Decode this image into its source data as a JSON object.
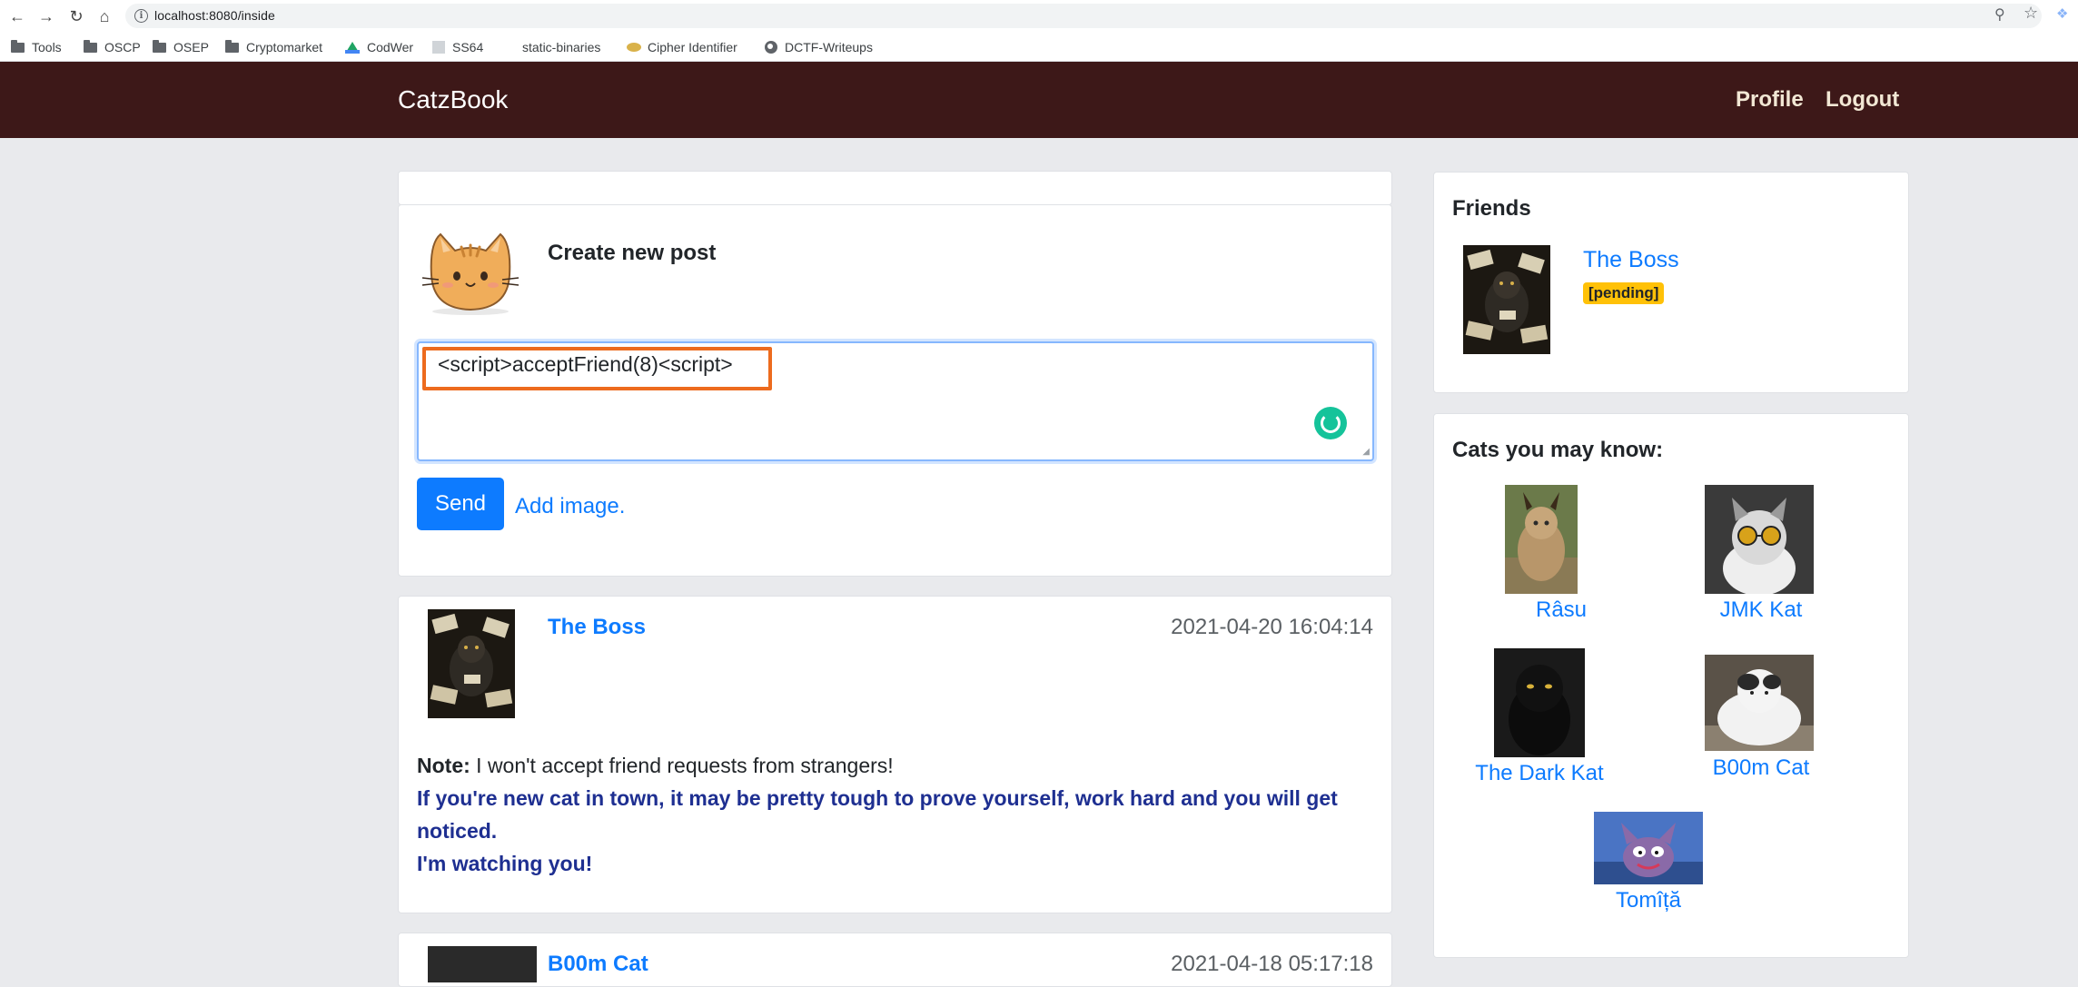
{
  "browser": {
    "url": "localhost:8080/inside",
    "bookmarks": [
      {
        "label": "Tools",
        "icon": "folder-icon"
      },
      {
        "label": "OSCP",
        "icon": "folder-icon"
      },
      {
        "label": "OSEP",
        "icon": "folder-icon"
      },
      {
        "label": "Cryptomarket",
        "icon": "folder-icon"
      },
      {
        "label": "CodWer",
        "icon": "google-drive-icon"
      },
      {
        "label": "SS64",
        "icon": "page-icon"
      },
      {
        "label": "static-binaries",
        "icon": "none"
      },
      {
        "label": "Cipher Identifier",
        "icon": "cipher-icon"
      },
      {
        "label": "DCTF-Writeups",
        "icon": "globe-icon"
      }
    ]
  },
  "navbar": {
    "brand": "CatzBook",
    "links": [
      "Profile",
      "Logout"
    ],
    "background": "#3d1818"
  },
  "create_post": {
    "title": "Create new post",
    "text_value": "<script>acceptFriend(8)<script>",
    "send_label": "Send",
    "add_image_label": "Add image."
  },
  "posts": [
    {
      "author": "The Boss",
      "date": "2021-04-20 16:04:14",
      "note_label": "Note:",
      "note_text": " I won't accept friend requests from strangers!",
      "highlight_line1": "If you're new cat in town, it may be pretty tough to prove yourself, work hard and you will get noticed.",
      "highlight_line2": "I'm watching you!"
    },
    {
      "author": "B00m Cat",
      "date": "2021-04-18 05:17:18"
    }
  ],
  "friends": {
    "title": "Friends",
    "items": [
      {
        "name": "The Boss",
        "status": "[pending]"
      }
    ]
  },
  "suggestions": {
    "title": "Cats you may know:",
    "items": [
      "Râsu",
      "JMK Kat",
      "The Dark Kat",
      "B00m Cat",
      "Tomîță"
    ]
  },
  "colors": {
    "accent": "#0d7bff",
    "highlight_border": "#ed6b1e",
    "pending_badge": "#ffc107",
    "post_emphasis": "#1e2f91"
  }
}
